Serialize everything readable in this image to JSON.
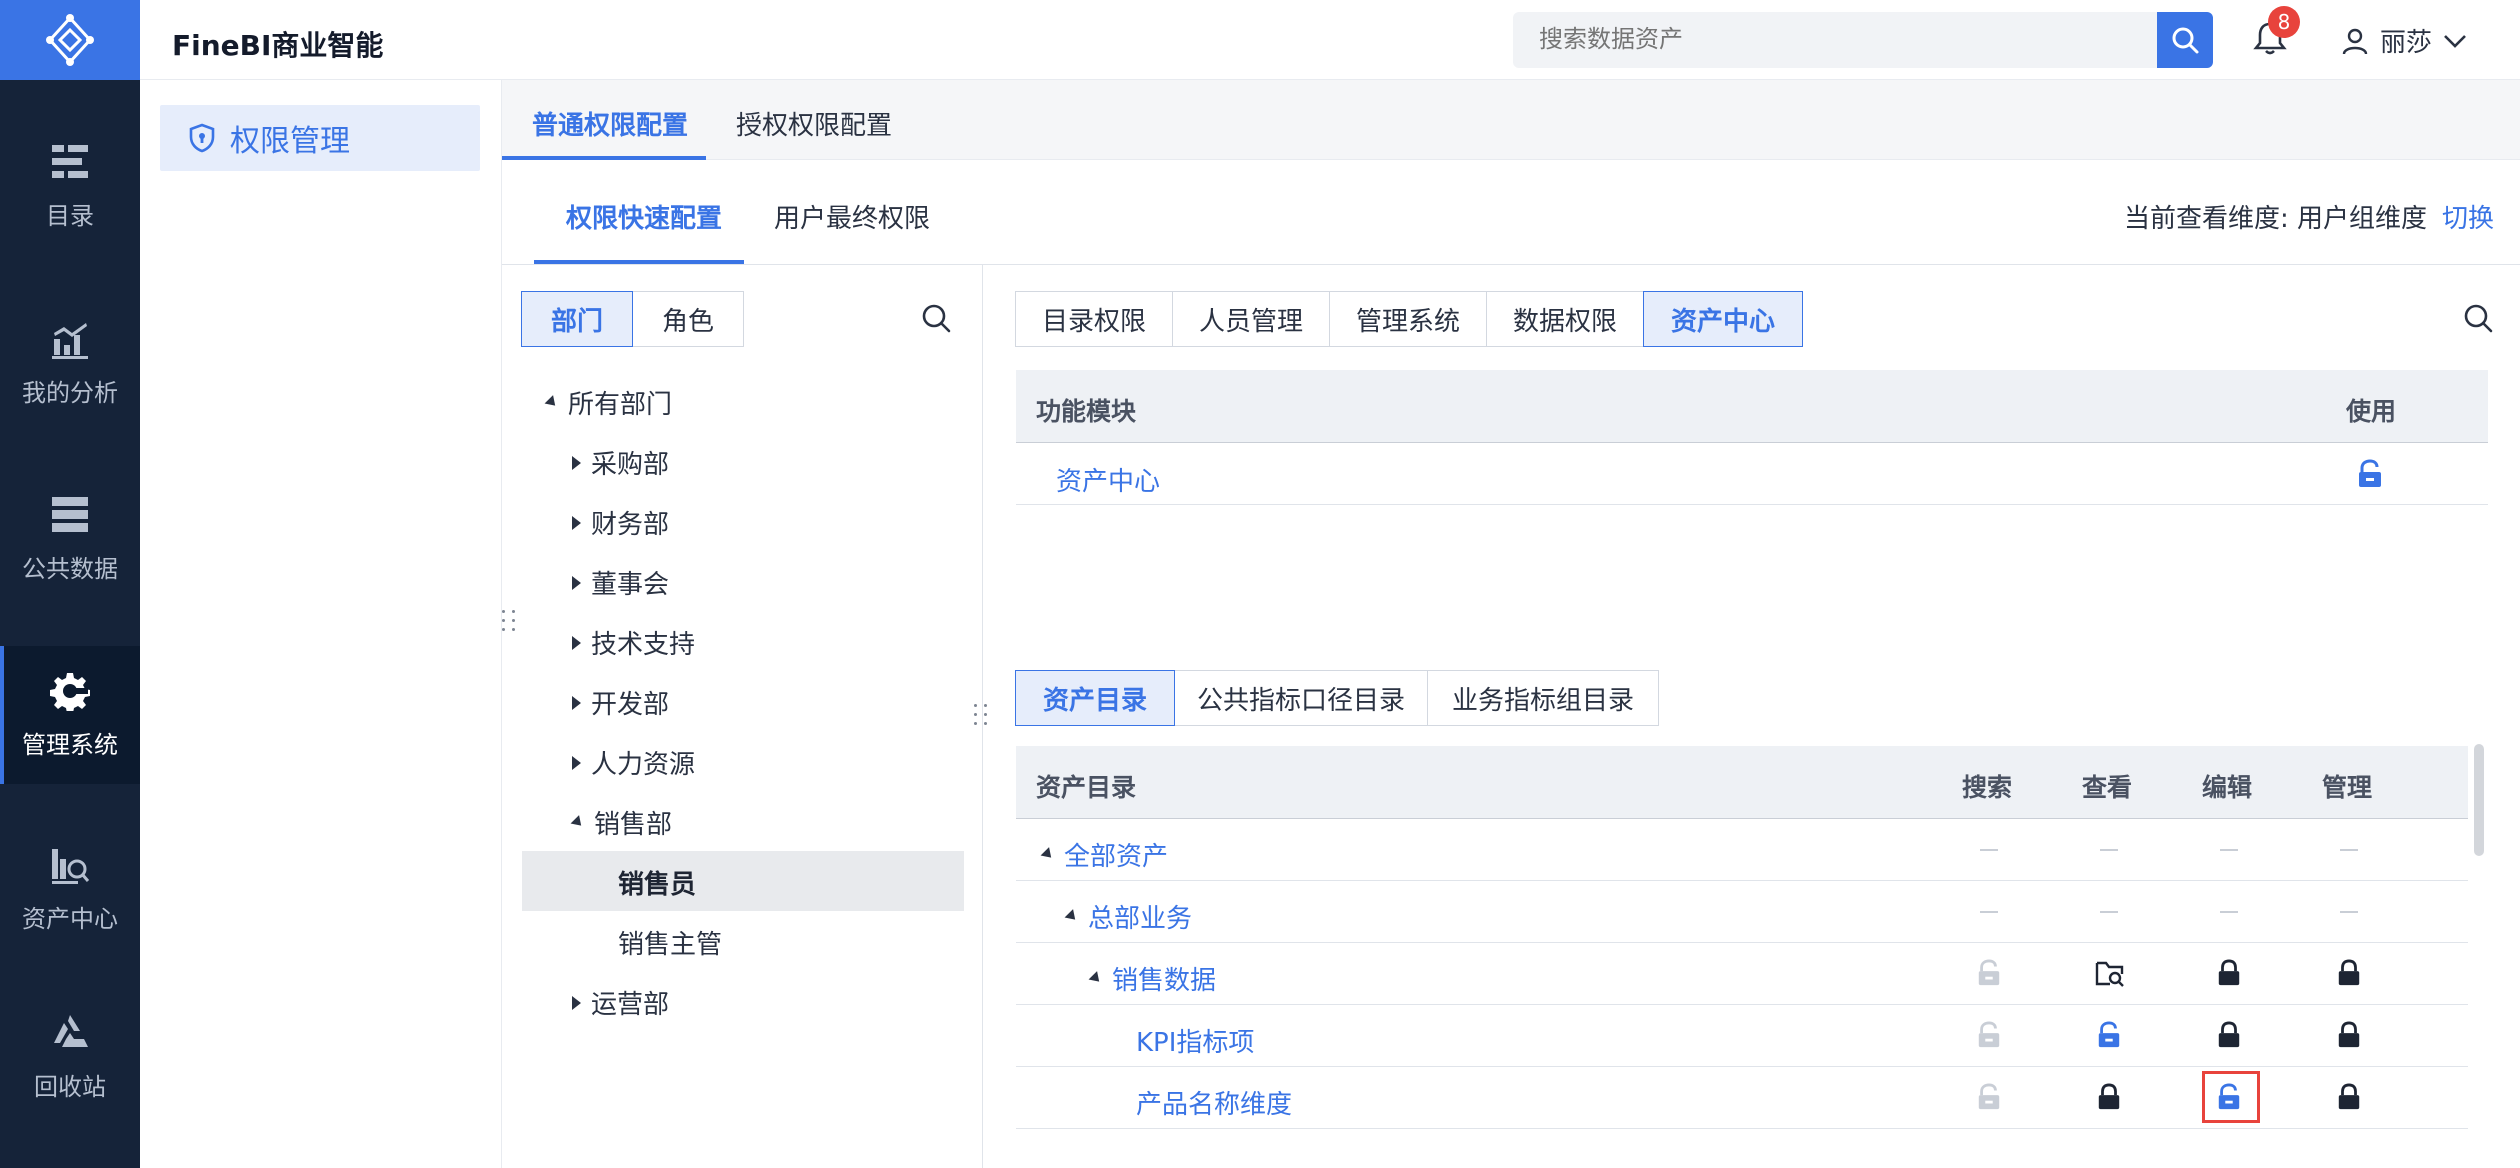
{
  "nav": {
    "items": [
      {
        "label": "目录",
        "icon": "catalog-icon"
      },
      {
        "label": "我的分析",
        "icon": "analysis-icon"
      },
      {
        "label": "公共数据",
        "icon": "public-data-icon"
      },
      {
        "label": "管理系统",
        "icon": "management-gear-icon",
        "active": true
      },
      {
        "label": "资产中心",
        "icon": "asset-center-icon"
      },
      {
        "label": "回收站",
        "icon": "recycle-bin-icon"
      }
    ]
  },
  "header": {
    "app_name": "FineBI商业智能",
    "search_placeholder": "搜索数据资产",
    "notifications": "8",
    "user": "丽莎"
  },
  "sidebar": {
    "menu_label": "权限管理"
  },
  "tabs": {
    "primary": [
      "普通权限配置",
      "授权权限配置"
    ],
    "secondary": [
      "权限快速配置",
      "用户最终权限"
    ]
  },
  "dimension": {
    "label": "当前查看维度:",
    "value": "用户组维度",
    "switch": "切换"
  },
  "left_panel": {
    "segments": [
      "部门",
      "角色"
    ],
    "tree": {
      "root": "所有部门",
      "departments": [
        "采购部",
        "财务部",
        "董事会",
        "技术支持",
        "开发部",
        "人力资源",
        "销售部"
      ],
      "sales_children": [
        "销售员",
        "销售主管"
      ],
      "last": "运营部"
    }
  },
  "permission_tabs": [
    "目录权限",
    "人员管理",
    "管理系统",
    "数据权限",
    "资产中心"
  ],
  "function_table": {
    "headers": [
      "功能模块",
      "使用"
    ],
    "row": "资产中心"
  },
  "asset_tabs": [
    "资产目录",
    "公共指标口径目录",
    "业务指标组目录"
  ],
  "asset_table": {
    "headers": [
      "资产目录",
      "搜索",
      "查看",
      "编辑",
      "管理"
    ],
    "rows": [
      {
        "name": "全部资产",
        "perms": [
          "dash",
          "dash",
          "dash",
          "dash"
        ]
      },
      {
        "name": "总部业务",
        "perms": [
          "dash",
          "dash",
          "dash",
          "dash"
        ]
      },
      {
        "name": "销售数据",
        "perms": [
          "unlock-gray",
          "folder-search",
          "lock-dark",
          "lock-dark"
        ]
      },
      {
        "name": "KPI指标项",
        "perms": [
          "unlock-gray",
          "unlock-blue",
          "lock-dark",
          "lock-dark"
        ]
      },
      {
        "name": "产品名称维度",
        "perms": [
          "unlock-gray",
          "lock-dark",
          "unlock-blue",
          "lock-dark"
        ]
      }
    ]
  },
  "colors": {
    "accent": "#3a74e5",
    "nav_bg": "#152339",
    "alert": "#e8433c"
  }
}
